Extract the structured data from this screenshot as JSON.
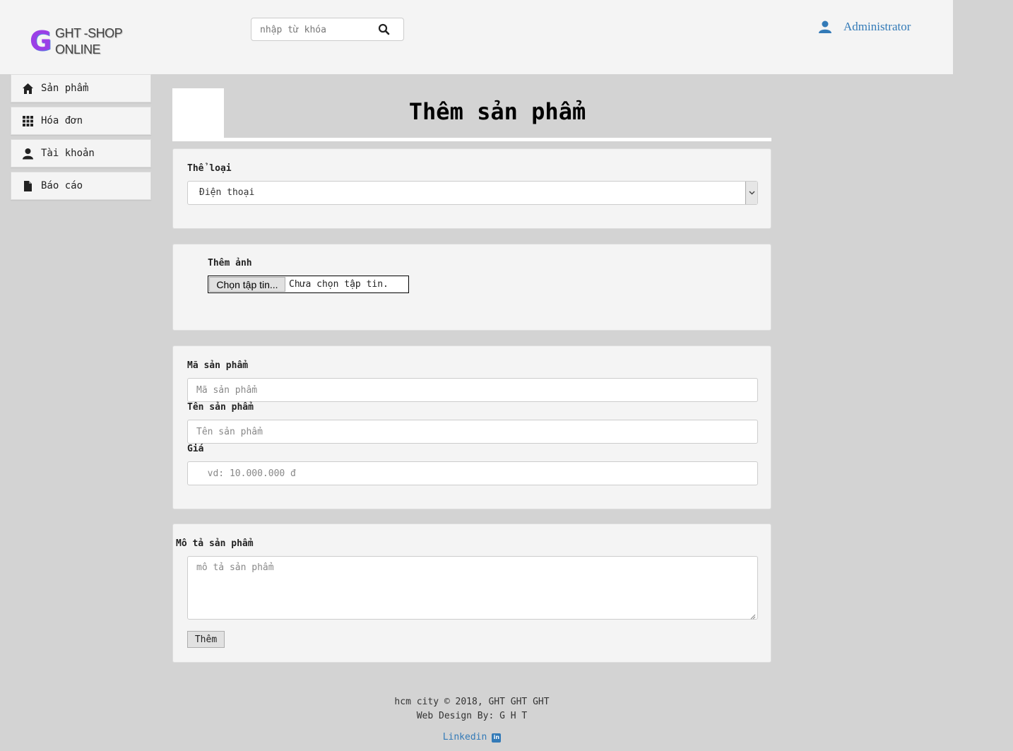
{
  "header": {
    "logo": {
      "letter": "G",
      "line1": "GHT -SHOP",
      "line2": "ONLINE"
    },
    "search": {
      "placeholder": "nhập từ khóa",
      "icon": "search-icon"
    },
    "user": {
      "name": "Administrator",
      "icon": "user-icon"
    }
  },
  "sidebar": {
    "items": [
      {
        "label": "Sản phẩm",
        "icon": "home-icon"
      },
      {
        "label": "Hóa đơn",
        "icon": "grid-icon"
      },
      {
        "label": "Tài khoản",
        "icon": "user-icon"
      },
      {
        "label": "Báo cáo",
        "icon": "file-icon"
      }
    ]
  },
  "page": {
    "title": "Thêm sản phẩm"
  },
  "category": {
    "label": "Thể loại",
    "selected": "Điện thoại"
  },
  "image": {
    "label": "Thêm ảnh",
    "button": "Chọn tập tin...",
    "status": "Chưa chọn tập tin."
  },
  "product": {
    "code_label": "Mã sản phẩm",
    "code_placeholder": "Mã sản phẩm",
    "name_label": "Tên sản phẩm",
    "name_placeholder": "Tên sản phẩm",
    "price_label": "Giá",
    "price_placeholder": "  vd: 10.000.000 đ"
  },
  "description": {
    "label": "Mô tả sản phẩm",
    "placeholder": "mô tả sản phẩm",
    "submit": "Thêm"
  },
  "footer": {
    "line1": "hcm city © 2018, GHT GHT GHT",
    "line2": "Web Design By: G H T",
    "link": "Linkedin",
    "link_icon": "linkedin-icon"
  },
  "colors": {
    "background": "#d3d3d3",
    "panel": "#f4f4f4",
    "link": "#337ab7",
    "logo": "#9b3fe6"
  }
}
